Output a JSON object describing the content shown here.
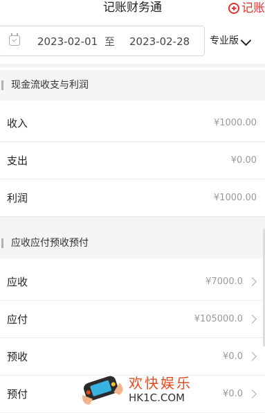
{
  "header": {
    "title": "记账财务通",
    "add_label": "记账"
  },
  "date_filter": {
    "start": "2023-02-01",
    "separator": "至",
    "end": "2023-02-28",
    "version_label": "专业版"
  },
  "sections": {
    "profit": {
      "title": "现金流收支与利润",
      "rows": [
        {
          "label": "收入",
          "value": "¥1000.00"
        },
        {
          "label": "支出",
          "value": "¥0.00"
        },
        {
          "label": "利润",
          "value": "¥1000.00"
        }
      ]
    },
    "receivables": {
      "title": "应收应付预收预付",
      "rows": [
        {
          "label": "应收",
          "value": "¥7000.0"
        },
        {
          "label": "应付",
          "value": "¥105000.0"
        },
        {
          "label": "预收",
          "value": "¥0.0"
        },
        {
          "label": "预付",
          "value": "¥0.0"
        }
      ]
    }
  },
  "watermark": {
    "brand": "欢快娱乐",
    "url": "HK1C.COM"
  }
}
